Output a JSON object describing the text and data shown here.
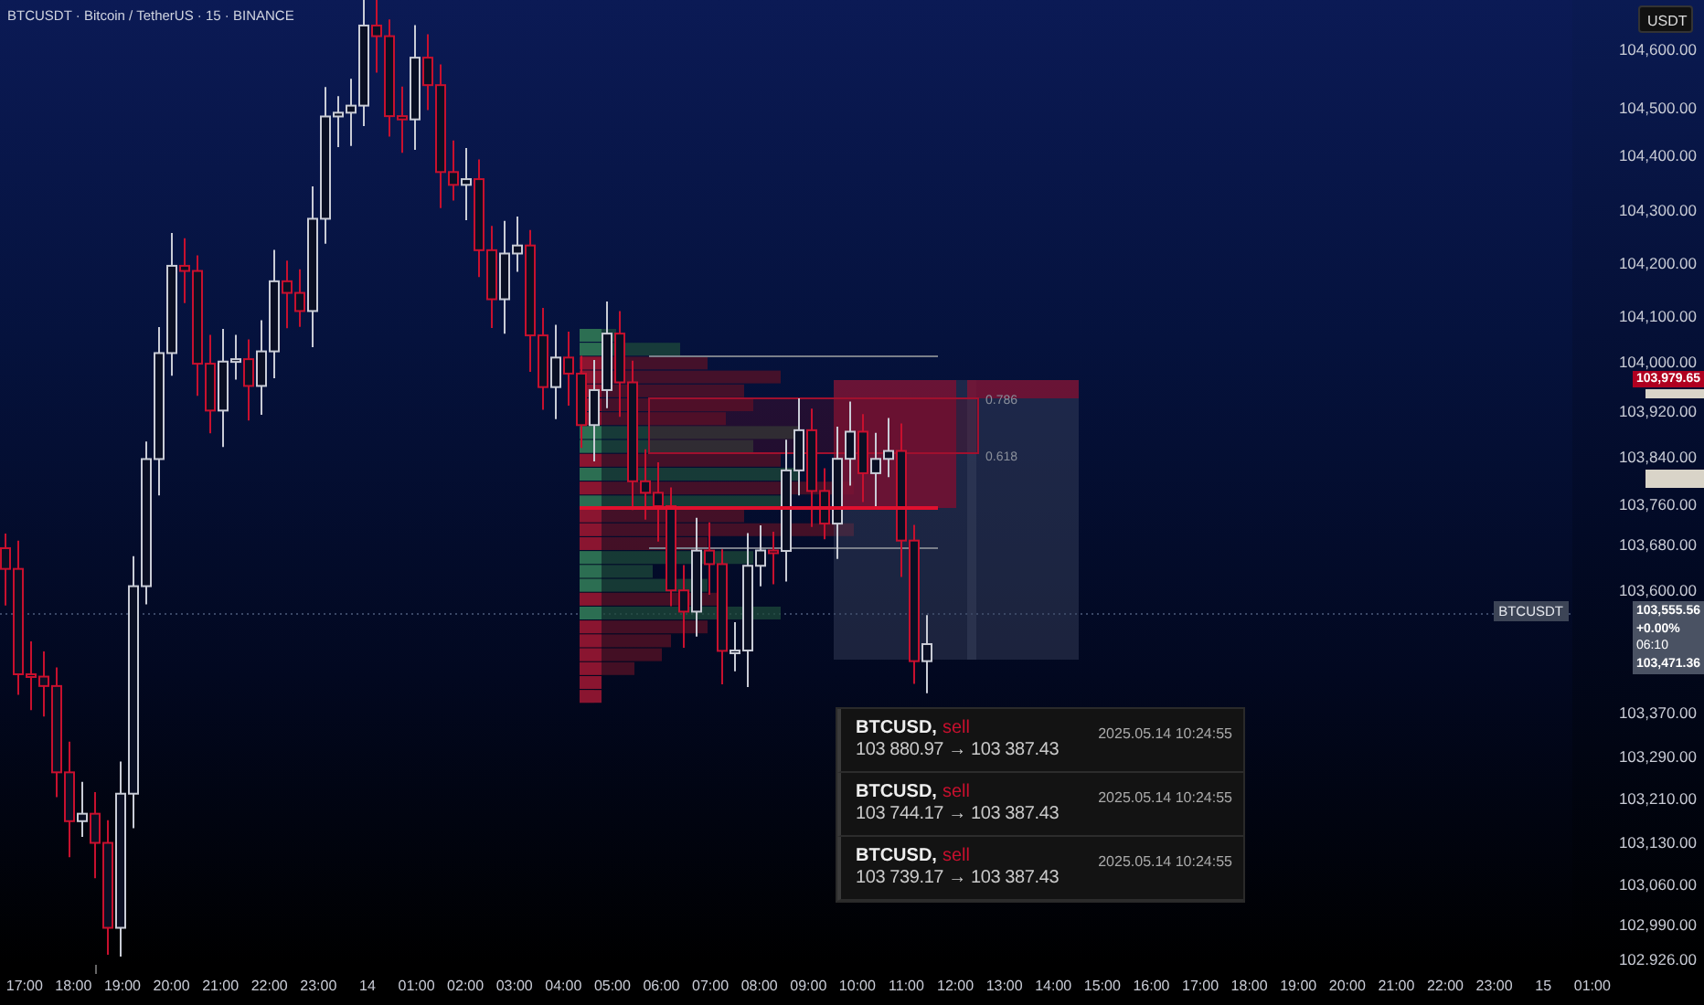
{
  "header": {
    "title": "BTCUSDT · Bitcoin / TetherUS · 15 · BINANCE"
  },
  "price_axis": {
    "currency": "USDT",
    "labels": [
      "104,600.00",
      "104,500.00",
      "104,400.00",
      "104,300.00",
      "104,200.00",
      "104,100.00",
      "104,000.00",
      "103,920.00",
      "103,840.00",
      "103,760.00",
      "103,680.00",
      "103,600.00",
      "103,370.00",
      "103,290.00",
      "103,210.00",
      "103,130.00",
      "103,060.00",
      "102,990.00",
      "102,926.00"
    ],
    "alert_price_tag": "103,979.65",
    "symbol_tag": "BTCUSDT",
    "price_box": [
      "103,555.56",
      "+0.00%",
      "06:10",
      "103,471.36"
    ]
  },
  "time_axis": {
    "labels": [
      "17:00",
      "18:00",
      "19:00",
      "20:00",
      "21:00",
      "22:00",
      "23:00",
      "14",
      "01:00",
      "02:00",
      "03:00",
      "04:00",
      "05:00",
      "06:00",
      "07:00",
      "08:00",
      "09:00",
      "10:00",
      "11:00",
      "12:00",
      "13:00",
      "14:00",
      "15:00",
      "16:00",
      "17:00",
      "18:00",
      "19:00",
      "20:00",
      "21:00",
      "22:00",
      "23:00",
      "15",
      "01:00"
    ]
  },
  "fib_levels": [
    "0.786",
    "0.618"
  ],
  "alerts": [
    {
      "symbol": "BTCUSD,",
      "side": "sell",
      "route": "103 880.97 → 103 387.43",
      "time": "2025.05.14 10:24:55"
    },
    {
      "symbol": "BTCUSD,",
      "side": "sell",
      "route": "103 744.17 → 103 387.43",
      "time": "2025.05.14 10:24:55"
    },
    {
      "symbol": "BTCUSD,",
      "side": "sell",
      "route": "103 739.17 → 103 387.43",
      "time": "2025.05.14 10:24:55"
    }
  ]
}
